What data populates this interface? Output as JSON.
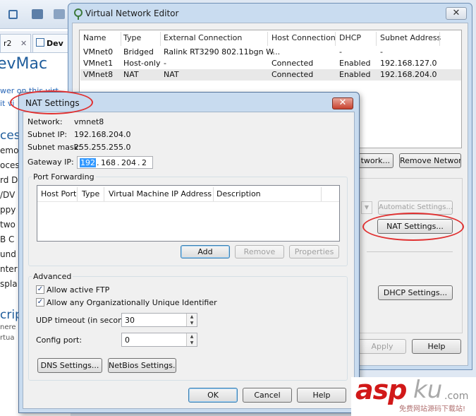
{
  "background_window": {
    "tabs": [
      {
        "label": "r2",
        "close": "✕"
      },
      {
        "label": "Dev"
      }
    ],
    "title": "evMac",
    "links": [
      "wer on this virt",
      "it vi"
    ],
    "side_labels": [
      "ces",
      "emo",
      "oces",
      "rd D",
      "/DV",
      "ppy",
      "two",
      "B C",
      "und",
      "nter",
      "spla"
    ],
    "section_label": "crip",
    "section_lines": [
      "nere",
      "rtua"
    ]
  },
  "vne": {
    "title": "Virtual Network Editor",
    "close_glyph": "✕",
    "columns": [
      "Name",
      "Type",
      "External Connection",
      "Host Connection",
      "DHCP",
      "Subnet Address"
    ],
    "rows": [
      {
        "name": "VMnet0",
        "type": "Bridged",
        "external": "Ralink RT3290 802.11bgn W...",
        "host": "-",
        "dhcp": "-",
        "subnet": "-"
      },
      {
        "name": "VMnet1",
        "type": "Host-only",
        "external": "-",
        "host": "Connected",
        "dhcp": "Enabled",
        "subnet": "192.168.127.0"
      },
      {
        "name": "VMnet8",
        "type": "NAT",
        "external": "NAT",
        "host": "Connected",
        "dhcp": "Enabled",
        "subnet": "192.168.204.0"
      }
    ],
    "buttons": {
      "add_network": "twork...",
      "remove_network": "Remove Network",
      "automatic_settings": "Automatic Settings...",
      "nat_settings": "NAT Settings...",
      "dhcp_settings": "DHCP Settings...",
      "apply": "Apply",
      "help": "Help"
    }
  },
  "nat": {
    "title": "NAT Settings",
    "close_glyph": "✕",
    "network_label": "Network:",
    "network_value": "vmnet8",
    "subnet_ip_label": "Subnet IP:",
    "subnet_ip_value": "192.168.204.0",
    "subnet_mask_label": "Subnet mask:",
    "subnet_mask_value": "255.255.255.0",
    "gateway_label": "Gateway IP:",
    "gateway_segments": [
      "192",
      "168",
      "204",
      "2"
    ],
    "port_forwarding_label": "Port Forwarding",
    "pf_columns": [
      "Host Port",
      "Type",
      "Virtual Machine IP Address",
      "Description"
    ],
    "pf_buttons": {
      "add": "Add",
      "remove": "Remove",
      "properties": "Properties"
    },
    "advanced_label": "Advanced",
    "allow_ftp_label": "Allow active FTP",
    "allow_oui_label": "Allow any Organizationally Unique Identifier",
    "udp_timeout_label": "UDP timeout (in seconds):",
    "udp_timeout_value": "30",
    "config_port_label": "Config port:",
    "config_port_value": "0",
    "dns_settings": "DNS Settings...",
    "netbios_settings": "NetBios Settings...",
    "ok": "OK",
    "cancel": "Cancel",
    "help": "Help"
  },
  "watermark": {
    "asp": "asp",
    "ku": "ku",
    "com": ".com",
    "sub": "免费网站源码下载站!"
  },
  "colors": {
    "accent_blue": "#3399ff",
    "annotation_red": "#e03030",
    "title_blue": "#1f5d9c"
  }
}
